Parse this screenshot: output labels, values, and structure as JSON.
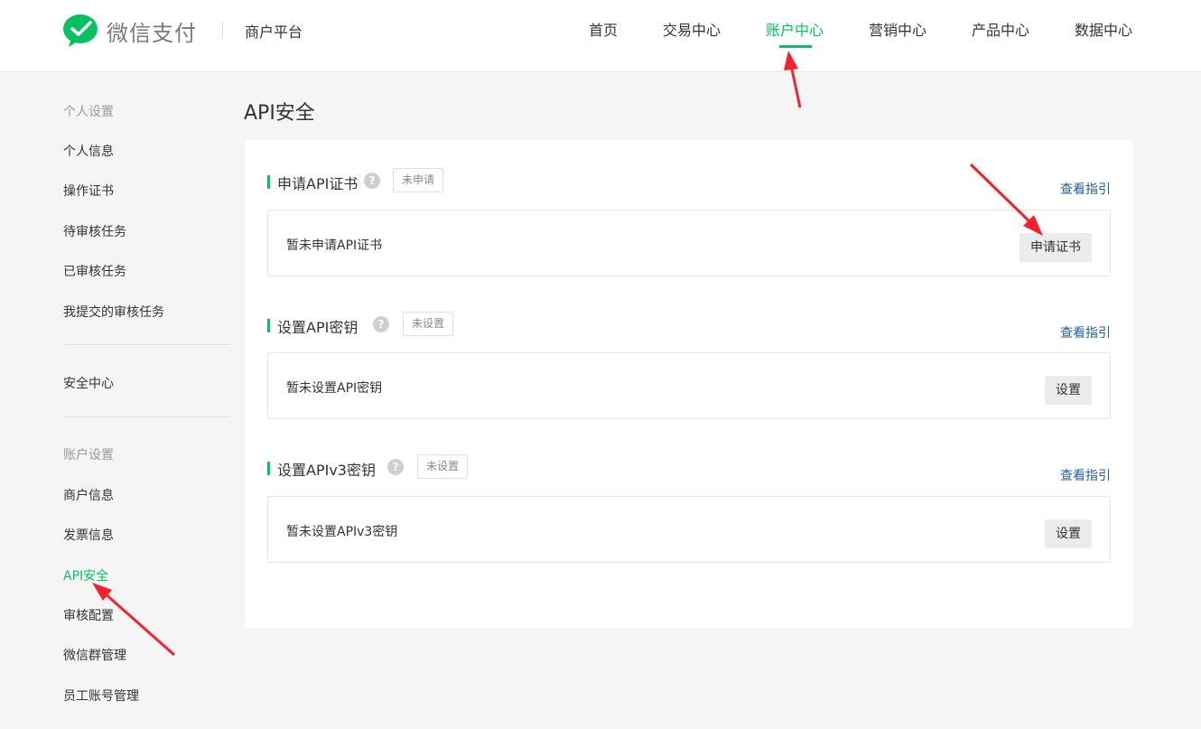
{
  "header": {
    "logo_text": "微信支付",
    "platform": "商户平台",
    "nav": [
      "首页",
      "交易中心",
      "账户中心",
      "营销中心",
      "产品中心",
      "数据中心"
    ],
    "active_nav": "账户中心"
  },
  "sidebar": {
    "group1_title": "个人设置",
    "group1_items": [
      "个人信息",
      "操作证书",
      "待审核任务",
      "已审核任务",
      "我提交的审核任务"
    ],
    "security": "安全中心",
    "group2_title": "账户设置",
    "group2_items": [
      "商户信息",
      "发票信息",
      "API安全",
      "审核配置",
      "微信群管理",
      "员工账号管理"
    ],
    "active_item": "API安全"
  },
  "main": {
    "title": "API安全",
    "sections": [
      {
        "title": "申请API证书",
        "status": "未申请",
        "guide": "查看指引",
        "text": "暂未申请API证书",
        "button": "申请证书"
      },
      {
        "title": "设置API密钥",
        "status": "未设置",
        "guide": "查看指引",
        "text": "暂未设置API密钥",
        "button": "设置"
      },
      {
        "title": "设置APIv3密钥",
        "status": "未设置",
        "guide": "查看指引",
        "text": "暂未设置APIv3密钥",
        "button": "设置"
      }
    ]
  },
  "colors": {
    "accent": "#07c160",
    "link": "#1f5fa8",
    "annotation": "#f5222d"
  }
}
